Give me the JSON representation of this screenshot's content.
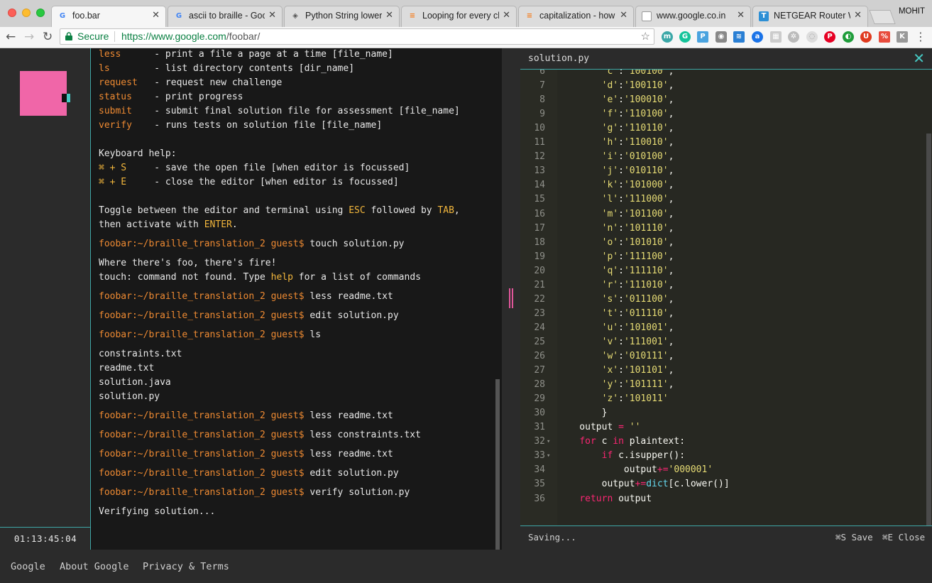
{
  "browser": {
    "tabs": [
      {
        "title": "foo.bar",
        "favicon": "google-g-icon",
        "active": true
      },
      {
        "title": "ascii to braille - Googl",
        "favicon": "google-g-icon",
        "active": false
      },
      {
        "title": "Python String lower()",
        "favicon": "diamond-icon",
        "active": false
      },
      {
        "title": "Looping for every char",
        "favicon": "stackoverflow-icon",
        "active": false
      },
      {
        "title": "capitalization - how ca",
        "favicon": "stackoverflow-icon",
        "active": false
      },
      {
        "title": "www.google.co.in",
        "favicon": "page-icon",
        "active": false
      },
      {
        "title": "NETGEAR Router WGR",
        "favicon": "netgear-t-icon",
        "active": false
      }
    ],
    "profile_name": "MOHIT",
    "secure_label": "Secure",
    "url_host": "https://www.google.com",
    "url_path": "/foobar/"
  },
  "sidebar": {
    "timer": "01:13:45:04"
  },
  "terminal": {
    "lines": [
      {
        "segs": [
          [
            "cmd",
            "less"
          ],
          [
            "",
            "      - print a file a page at a time [file_name]"
          ]
        ]
      },
      {
        "segs": [
          [
            "cmd",
            "ls"
          ],
          [
            "",
            "        - list directory contents [dir_name]"
          ]
        ]
      },
      {
        "segs": [
          [
            "cmd",
            "request"
          ],
          [
            "",
            "   - request new challenge"
          ]
        ]
      },
      {
        "segs": [
          [
            "cmd",
            "status"
          ],
          [
            "",
            "    - print progress"
          ]
        ]
      },
      {
        "segs": [
          [
            "cmd",
            "submit"
          ],
          [
            "",
            "    - submit final solution file for assessment [file_name]"
          ]
        ]
      },
      {
        "segs": [
          [
            "cmd",
            "verify"
          ],
          [
            "",
            "    - runs tests on solution file [file_name]"
          ]
        ]
      },
      {
        "segs": [
          [
            "",
            ""
          ]
        ]
      },
      {
        "segs": [
          [
            "",
            "Keyboard help:"
          ]
        ]
      },
      {
        "segs": [
          [
            "hl",
            "⌘ + S"
          ],
          [
            "",
            "     - save the open file [when editor is focussed]"
          ]
        ]
      },
      {
        "segs": [
          [
            "hl",
            "⌘ + E"
          ],
          [
            "",
            "     - close the editor [when editor is focussed]"
          ]
        ]
      },
      {
        "segs": [
          [
            "",
            ""
          ]
        ]
      },
      {
        "segs": [
          [
            "",
            "Toggle between the editor and terminal using "
          ],
          [
            "hl",
            "ESC"
          ],
          [
            "",
            " followed by "
          ],
          [
            "hl",
            "TAB"
          ],
          [
            "",
            ","
          ]
        ]
      },
      {
        "segs": [
          [
            "",
            "then activate with "
          ],
          [
            "hl",
            "ENTER"
          ],
          [
            "",
            "."
          ]
        ]
      },
      {
        "segs": [
          [
            "cmd",
            "foobar:~/braille_translation_2 guest$"
          ],
          [
            "",
            " touch solution.py"
          ]
        ],
        "gap": 7
      },
      {
        "segs": [
          [
            "",
            "Where there's foo, there's fire!"
          ]
        ],
        "gap": 7
      },
      {
        "segs": [
          [
            "",
            "touch: command not found. Type "
          ],
          [
            "hl",
            "help"
          ],
          [
            "",
            " for a list of commands"
          ]
        ]
      },
      {
        "segs": [
          [
            "cmd",
            "foobar:~/braille_translation_2 guest$"
          ],
          [
            "",
            " less readme.txt"
          ]
        ],
        "gap": 7
      },
      {
        "segs": [
          [
            "cmd",
            "foobar:~/braille_translation_2 guest$"
          ],
          [
            "",
            " edit solution.py"
          ]
        ],
        "gap": 7
      },
      {
        "segs": [
          [
            "cmd",
            "foobar:~/braille_translation_2 guest$"
          ],
          [
            "",
            " ls"
          ]
        ],
        "gap": 7
      },
      {
        "segs": [
          [
            "",
            "constraints.txt"
          ]
        ],
        "gap": 7
      },
      {
        "segs": [
          [
            "",
            "readme.txt"
          ]
        ]
      },
      {
        "segs": [
          [
            "",
            "solution.java"
          ]
        ]
      },
      {
        "segs": [
          [
            "",
            "solution.py"
          ]
        ]
      },
      {
        "segs": [
          [
            "cmd",
            "foobar:~/braille_translation_2 guest$"
          ],
          [
            "",
            " less readme.txt"
          ]
        ],
        "gap": 7
      },
      {
        "segs": [
          [
            "cmd",
            "foobar:~/braille_translation_2 guest$"
          ],
          [
            "",
            " less constraints.txt"
          ]
        ],
        "gap": 7
      },
      {
        "segs": [
          [
            "cmd",
            "foobar:~/braille_translation_2 guest$"
          ],
          [
            "",
            " less readme.txt"
          ]
        ],
        "gap": 7
      },
      {
        "segs": [
          [
            "cmd",
            "foobar:~/braille_translation_2 guest$"
          ],
          [
            "",
            " edit solution.py"
          ]
        ],
        "gap": 7
      },
      {
        "segs": [
          [
            "cmd",
            "foobar:~/braille_translation_2 guest$"
          ],
          [
            "",
            " verify solution.py"
          ]
        ],
        "gap": 7
      },
      {
        "segs": [
          [
            "",
            "Verifying solution..."
          ]
        ],
        "gap": 7
      }
    ]
  },
  "editor": {
    "filename": "solution.py",
    "close_icon": "close-x-icon",
    "status": "Saving...",
    "save_hint": "⌘S Save",
    "close_hint": "⌘E Close",
    "lines": [
      {
        "n": "6",
        "segs": [
          [
            "",
            "        "
          ],
          [
            "str",
            "'c'"
          ],
          [
            "",
            ":"
          ],
          [
            "str",
            "'100100'"
          ],
          [
            "",
            ","
          ]
        ]
      },
      {
        "n": "7",
        "segs": [
          [
            "",
            "        "
          ],
          [
            "str",
            "'d'"
          ],
          [
            "",
            ":"
          ],
          [
            "str",
            "'100110'"
          ],
          [
            "",
            ","
          ]
        ]
      },
      {
        "n": "8",
        "segs": [
          [
            "",
            "        "
          ],
          [
            "str",
            "'e'"
          ],
          [
            "",
            ":"
          ],
          [
            "str",
            "'100010'"
          ],
          [
            "",
            ","
          ]
        ]
      },
      {
        "n": "9",
        "segs": [
          [
            "",
            "        "
          ],
          [
            "str",
            "'f'"
          ],
          [
            "",
            ":"
          ],
          [
            "str",
            "'110100'"
          ],
          [
            "",
            ","
          ]
        ]
      },
      {
        "n": "10",
        "segs": [
          [
            "",
            "        "
          ],
          [
            "str",
            "'g'"
          ],
          [
            "",
            ":"
          ],
          [
            "str",
            "'110110'"
          ],
          [
            "",
            ","
          ]
        ]
      },
      {
        "n": "11",
        "segs": [
          [
            "",
            "        "
          ],
          [
            "str",
            "'h'"
          ],
          [
            "",
            ":"
          ],
          [
            "str",
            "'110010'"
          ],
          [
            "",
            ","
          ]
        ]
      },
      {
        "n": "12",
        "segs": [
          [
            "",
            "        "
          ],
          [
            "str",
            "'i'"
          ],
          [
            "",
            ":"
          ],
          [
            "str",
            "'010100'"
          ],
          [
            "",
            ","
          ]
        ]
      },
      {
        "n": "13",
        "segs": [
          [
            "",
            "        "
          ],
          [
            "str",
            "'j'"
          ],
          [
            "",
            ":"
          ],
          [
            "str",
            "'010110'"
          ],
          [
            "",
            ","
          ]
        ]
      },
      {
        "n": "14",
        "segs": [
          [
            "",
            "        "
          ],
          [
            "str",
            "'k'"
          ],
          [
            "",
            ":"
          ],
          [
            "str",
            "'101000'"
          ],
          [
            "",
            ","
          ]
        ]
      },
      {
        "n": "15",
        "segs": [
          [
            "",
            "        "
          ],
          [
            "str",
            "'l'"
          ],
          [
            "",
            ":"
          ],
          [
            "str",
            "'111000'"
          ],
          [
            "",
            ","
          ]
        ]
      },
      {
        "n": "16",
        "segs": [
          [
            "",
            "        "
          ],
          [
            "str",
            "'m'"
          ],
          [
            "",
            ":"
          ],
          [
            "str",
            "'101100'"
          ],
          [
            "",
            ","
          ]
        ]
      },
      {
        "n": "17",
        "segs": [
          [
            "",
            "        "
          ],
          [
            "str",
            "'n'"
          ],
          [
            "",
            ":"
          ],
          [
            "str",
            "'101110'"
          ],
          [
            "",
            ","
          ]
        ]
      },
      {
        "n": "18",
        "segs": [
          [
            "",
            "        "
          ],
          [
            "str",
            "'o'"
          ],
          [
            "",
            ":"
          ],
          [
            "str",
            "'101010'"
          ],
          [
            "",
            ","
          ]
        ]
      },
      {
        "n": "19",
        "segs": [
          [
            "",
            "        "
          ],
          [
            "str",
            "'p'"
          ],
          [
            "",
            ":"
          ],
          [
            "str",
            "'111100'"
          ],
          [
            "",
            ","
          ]
        ]
      },
      {
        "n": "20",
        "segs": [
          [
            "",
            "        "
          ],
          [
            "str",
            "'q'"
          ],
          [
            "",
            ":"
          ],
          [
            "str",
            "'111110'"
          ],
          [
            "",
            ","
          ]
        ]
      },
      {
        "n": "21",
        "segs": [
          [
            "",
            "        "
          ],
          [
            "str",
            "'r'"
          ],
          [
            "",
            ":"
          ],
          [
            "str",
            "'111010'"
          ],
          [
            "",
            ","
          ]
        ]
      },
      {
        "n": "22",
        "segs": [
          [
            "",
            "        "
          ],
          [
            "str",
            "'s'"
          ],
          [
            "",
            ":"
          ],
          [
            "str",
            "'011100'"
          ],
          [
            "",
            ","
          ]
        ]
      },
      {
        "n": "23",
        "segs": [
          [
            "",
            "        "
          ],
          [
            "str",
            "'t'"
          ],
          [
            "",
            ":"
          ],
          [
            "str",
            "'011110'"
          ],
          [
            "",
            ","
          ]
        ]
      },
      {
        "n": "24",
        "segs": [
          [
            "",
            "        "
          ],
          [
            "str",
            "'u'"
          ],
          [
            "",
            ":"
          ],
          [
            "str",
            "'101001'"
          ],
          [
            "",
            ","
          ]
        ]
      },
      {
        "n": "25",
        "segs": [
          [
            "",
            "        "
          ],
          [
            "str",
            "'v'"
          ],
          [
            "",
            ":"
          ],
          [
            "str",
            "'111001'"
          ],
          [
            "",
            ","
          ]
        ]
      },
      {
        "n": "26",
        "segs": [
          [
            "",
            "        "
          ],
          [
            "str",
            "'w'"
          ],
          [
            "",
            ":"
          ],
          [
            "str",
            "'010111'"
          ],
          [
            "",
            ","
          ]
        ]
      },
      {
        "n": "27",
        "segs": [
          [
            "",
            "        "
          ],
          [
            "str",
            "'x'"
          ],
          [
            "",
            ":"
          ],
          [
            "str",
            "'101101'"
          ],
          [
            "",
            ","
          ]
        ]
      },
      {
        "n": "28",
        "segs": [
          [
            "",
            "        "
          ],
          [
            "str",
            "'y'"
          ],
          [
            "",
            ":"
          ],
          [
            "str",
            "'101111'"
          ],
          [
            "",
            ","
          ]
        ]
      },
      {
        "n": "29",
        "segs": [
          [
            "",
            "        "
          ],
          [
            "str",
            "'z'"
          ],
          [
            "",
            ":"
          ],
          [
            "str",
            "'101011'"
          ]
        ]
      },
      {
        "n": "30",
        "segs": [
          [
            "",
            "        }"
          ]
        ]
      },
      {
        "n": "31",
        "segs": [
          [
            "",
            "    output "
          ],
          [
            "kw",
            "="
          ],
          [
            "",
            " "
          ],
          [
            "str",
            "''"
          ]
        ]
      },
      {
        "n": "32",
        "fold": true,
        "segs": [
          [
            "",
            "    "
          ],
          [
            "kw",
            "for"
          ],
          [
            "",
            " c "
          ],
          [
            "kw",
            "in"
          ],
          [
            "",
            " plaintext:"
          ]
        ]
      },
      {
        "n": "33",
        "fold": true,
        "segs": [
          [
            "",
            "        "
          ],
          [
            "kw",
            "if"
          ],
          [
            "",
            " c.isupper():"
          ]
        ]
      },
      {
        "n": "34",
        "segs": [
          [
            "",
            "            output"
          ],
          [
            "kw",
            "+="
          ],
          [
            "str",
            "'000001'"
          ]
        ]
      },
      {
        "n": "35",
        "segs": [
          [
            "",
            "        output"
          ],
          [
            "kw",
            "+="
          ],
          [
            "bi",
            "dict"
          ],
          [
            "",
            "[c.lower()]"
          ]
        ]
      },
      {
        "n": "36",
        "segs": [
          [
            "",
            "    "
          ],
          [
            "kw",
            "return"
          ],
          [
            "",
            " output"
          ]
        ]
      }
    ]
  },
  "footer": {
    "links": [
      "Google",
      "About Google",
      "Privacy & Terms"
    ]
  }
}
